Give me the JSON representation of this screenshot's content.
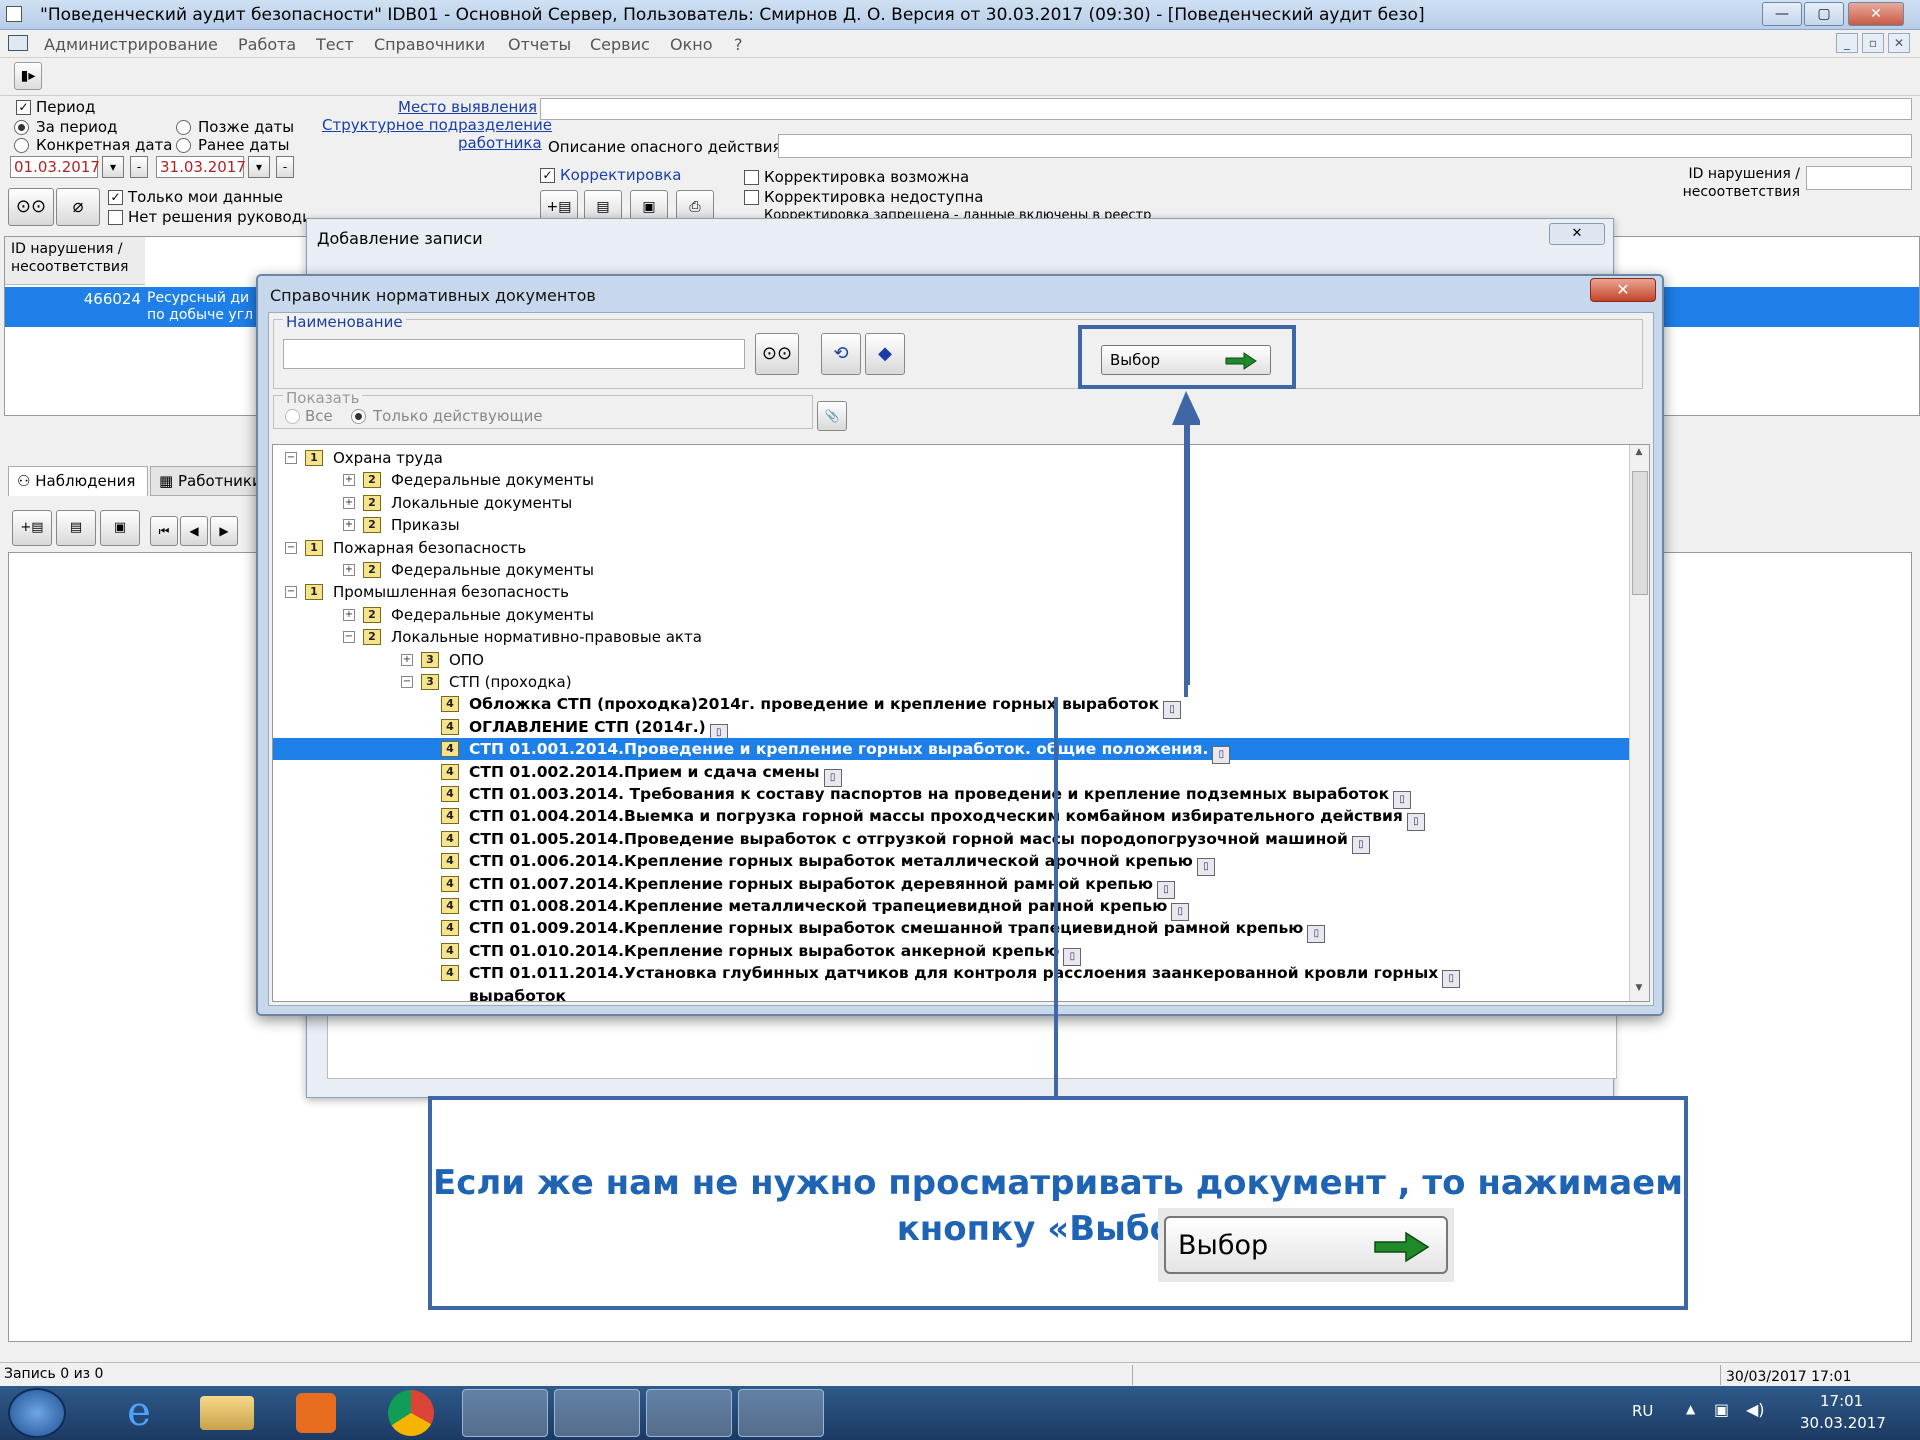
{
  "window": {
    "title": "\"Поведенческий аудит безопасности\"    IDB01 - Основной Сервер,    Пользователь: Смирнов Д. О.    Версия от 30.03.2017 (09:30) - [Поведенческий аудит безо]",
    "min": "—",
    "max": "▢",
    "close": "✕"
  },
  "menu": [
    "Администрирование",
    "Работа",
    "Тест",
    "Справочники",
    "Отчеты",
    "Сервис",
    "Окно",
    "?"
  ],
  "filter": {
    "period_label": "Период",
    "for_period": "За период",
    "specific_date": "Конкретная дата",
    "after_date": "Позже даты",
    "before_date": "Ранее даты",
    "date_from": "01.03.2017",
    "date_to": "31.03.2017",
    "only_my": "Только мои данные",
    "no_decision": "Нет решения руководителя",
    "place_link": "Место выявления",
    "dept_link_1": "Структурное подразделение",
    "dept_link_2": "работника",
    "danger_desc": "Описание опасного действия",
    "correction": "Корректировка",
    "corr_possible": "Корректировка возможна",
    "corr_unavailable": "Корректировка недоступна",
    "corr_forbidden": "Корректировка запрещена - данные включены в реестр",
    "violation_id_1": "ID нарушения /",
    "violation_id_2": "несоответствия"
  },
  "grid": {
    "header_1": "ID нарушения /",
    "header_2": "несоответствия",
    "row_id": "466024",
    "row_text_1": "Ресурсный ди",
    "row_text_2": "по добыче угл"
  },
  "tabs": {
    "observations": "Наблюдения",
    "workers": "Работники"
  },
  "bg_dialog": {
    "title": "Добавление записи",
    "close": "✕"
  },
  "dialog": {
    "title": "Справочник нормативных документов",
    "close": "✕",
    "name_label": "Наименование",
    "name_value": "",
    "show_label": "Показать",
    "show_all": "Все",
    "show_active": "Только действующие",
    "select_btn": "Выбор"
  },
  "tree": [
    {
      "level": 1,
      "num": "1",
      "exp": "−",
      "text": "Охрана труда"
    },
    {
      "level": 2,
      "num": "2",
      "exp": "+",
      "text": "Федеральные документы"
    },
    {
      "level": 2,
      "num": "2",
      "exp": "+",
      "text": "Локальные документы"
    },
    {
      "level": 2,
      "num": "2",
      "exp": "+",
      "text": "Приказы"
    },
    {
      "level": 1,
      "num": "1",
      "exp": "−",
      "text": "Пожарная безопасность"
    },
    {
      "level": 2,
      "num": "2",
      "exp": "+",
      "text": "Федеральные документы"
    },
    {
      "level": 1,
      "num": "1",
      "exp": "−",
      "text": "Промышленная безопасность"
    },
    {
      "level": 2,
      "num": "2",
      "exp": "+",
      "text": "Федеральные документы"
    },
    {
      "level": 2,
      "num": "2",
      "exp": "−",
      "text": "Локальные нормативно-правовые акта"
    },
    {
      "level": 3,
      "num": "3",
      "exp": "+",
      "text": "ОПО"
    },
    {
      "level": 3,
      "num": "3",
      "exp": "−",
      "text": "СТП (проходка)"
    },
    {
      "level": 4,
      "num": "4",
      "doc": true,
      "text": "Обложка СТП (проходка)2014г. проведение и крепление горных выработок"
    },
    {
      "level": 4,
      "num": "4",
      "doc": true,
      "text": "ОГЛАВЛЕНИЕ СТП (2014г.)"
    },
    {
      "level": 4,
      "num": "4",
      "doc": true,
      "sel": true,
      "text": "СТП 01.001.2014.Проведение и крепление горных выработок. общие положения."
    },
    {
      "level": 4,
      "num": "4",
      "doc": true,
      "text": "СТП 01.002.2014.Прием и сдача смены"
    },
    {
      "level": 4,
      "num": "4",
      "doc": true,
      "text": "СТП 01.003.2014.  Требования к составу паспортов на проведение и крепление подземных выработок"
    },
    {
      "level": 4,
      "num": "4",
      "doc": true,
      "text": "СТП 01.004.2014.Выемка и погрузка горной массы проходческим комбайном избирательного действия"
    },
    {
      "level": 4,
      "num": "4",
      "doc": true,
      "text": "СТП 01.005.2014.Проведение выработок с отгрузкой горной массы породопогрузочной машиной"
    },
    {
      "level": 4,
      "num": "4",
      "doc": true,
      "text": "СТП 01.006.2014.Крепление горных выработок металлической арочной крепью"
    },
    {
      "level": 4,
      "num": "4",
      "doc": true,
      "text": "СТП 01.007.2014.Крепление горных выработок деревянной рамной крепью"
    },
    {
      "level": 4,
      "num": "4",
      "doc": true,
      "text": "СТП 01.008.2014.Крепление металлической трапециевидной рамной крепью"
    },
    {
      "level": 4,
      "num": "4",
      "doc": true,
      "text": "СТП 01.009.2014.Крепление горных выработок смешанной трапециевидной рамной крепью"
    },
    {
      "level": 4,
      "num": "4",
      "doc": true,
      "text": "СТП 01.010.2014.Крепление горных выработок анкерной крепью"
    },
    {
      "level": 4,
      "num": "4",
      "doc": true,
      "text": "СТП 01.011.2014.Установка глубинных датчиков для контроля расслоения заанкерованной кровли горных"
    },
    {
      "level": 4,
      "num": "",
      "doc": true,
      "cont": true,
      "text": "выработок"
    }
  ],
  "callout": {
    "text": "Если же нам не нужно просматривать документ , то нажимаем кнопку «Выбор»",
    "button": "Выбор"
  },
  "status": {
    "records": "Запись  0  из  0",
    "datetime": "30/03/2017 17:01"
  },
  "taskbar": {
    "lang": "RU",
    "time": "17:01",
    "date": "30.03.2017"
  },
  "colors": {
    "selection": "#1e7fe8",
    "callout_border": "#3f67a5",
    "callout_text": "#1f63b5",
    "date_text": "#b22222"
  }
}
